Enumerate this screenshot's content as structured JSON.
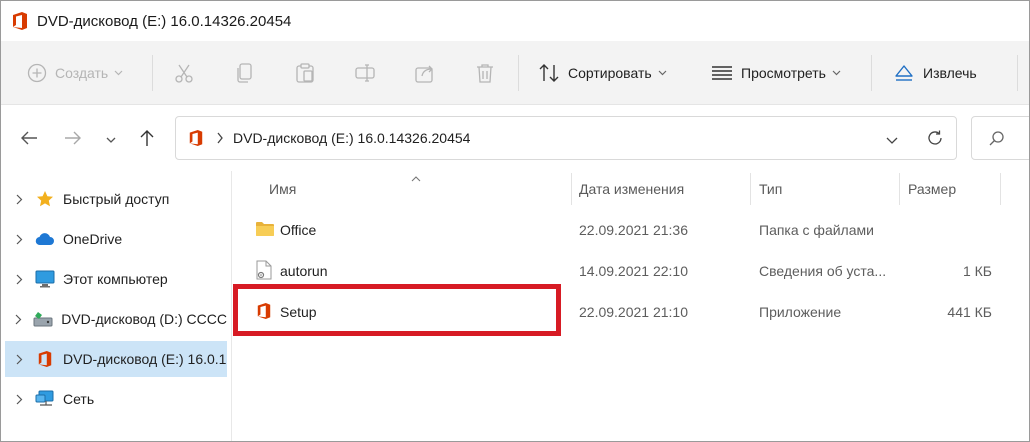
{
  "window": {
    "title": "DVD-дисковод (E:) 16.0.14326.20454",
    "icon": "office-icon"
  },
  "toolbar": {
    "new_label": "Создать",
    "sort_label": "Сортировать",
    "view_label": "Просмотреть",
    "eject_label": "Извлечь"
  },
  "address": {
    "path": "DVD-дисковод (E:) 16.0.14326.20454"
  },
  "sidebar": {
    "items": [
      {
        "label": "Быстрый доступ",
        "icon": "star-icon"
      },
      {
        "label": "OneDrive",
        "icon": "cloud-icon"
      },
      {
        "label": "Этот компьютер",
        "icon": "monitor-icon"
      },
      {
        "label": "DVD-дисковод (D:) CCCC",
        "icon": "dvd-drive-icon"
      },
      {
        "label": "DVD-дисковод (E:) 16.0.1",
        "icon": "office-icon",
        "selected": true
      },
      {
        "label": "Сеть",
        "icon": "network-icon"
      }
    ]
  },
  "columns": {
    "name": "Имя",
    "date": "Дата изменения",
    "type": "Тип",
    "size": "Размер"
  },
  "files": [
    {
      "name": "Office",
      "date": "22.09.2021 21:36",
      "type": "Папка с файлами",
      "size": "",
      "icon": "folder-icon"
    },
    {
      "name": "autorun",
      "date": "14.09.2021 22:10",
      "type": "Сведения об уста...",
      "size": "1 КБ",
      "icon": "settings-file-icon"
    },
    {
      "name": "Setup",
      "date": "22.09.2021 21:10",
      "type": "Приложение",
      "size": "441 КБ",
      "icon": "office-icon"
    }
  ],
  "colors": {
    "accent_selected": "#cce4f7",
    "highlight_box": "#d71b24",
    "office_red": "#d83b01"
  }
}
